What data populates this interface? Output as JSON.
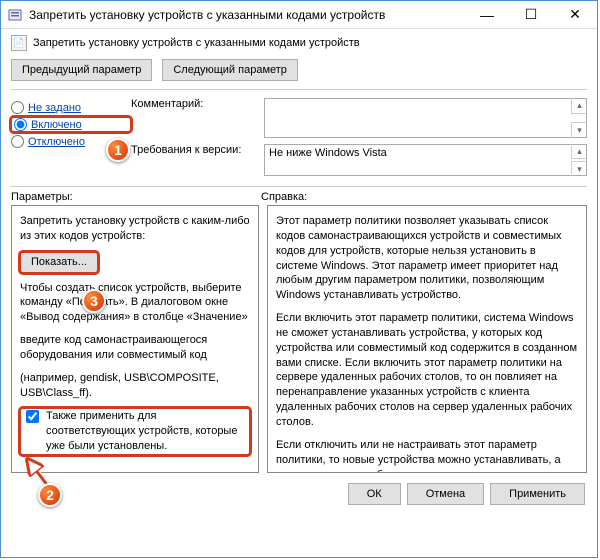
{
  "window": {
    "title": "Запретить установку устройств с указанными кодами устройств"
  },
  "subheader": {
    "title": "Запретить установку устройств с указанными кодами устройств"
  },
  "nav": {
    "prev": "Предыдущий параметр",
    "next": "Следующий параметр"
  },
  "state": {
    "not_configured": "Не задано",
    "enabled": "Включено",
    "disabled": "Отключено",
    "selected": "enabled"
  },
  "comment": {
    "label": "Комментарий:",
    "value": ""
  },
  "supported": {
    "label": "Требования к версии:",
    "value": "Не ниже Windows Vista"
  },
  "labels": {
    "options": "Параметры:",
    "help": "Справка:"
  },
  "options": {
    "intro": "Запретить установку устройств с каким-либо из этих кодов устройств:",
    "show_button": "Показать...",
    "hint1": "Чтобы создать список устройств, выберите команду «Показать». В диалоговом окне «Вывод содержания» в столбце «Значение»",
    "hint2": "введите код самонастраивающегося оборудования или совместимый код",
    "hint3": "(например, gendisk, USB\\COMPOSITE, USB\\Class_ff).",
    "checkbox_label": "Также применить для соответствующих устройств, которые уже были установлены.",
    "checkbox_checked": true
  },
  "help": {
    "p1": "Этот параметр политики позволяет указывать список кодов самонастраивающихся устройств и совместимых кодов для устройств, которые нельзя установить в системе Windows. Этот параметр имеет приоритет над любым другим параметром политики, позволяющим Windows устанавливать устройство.",
    "p2": "Если включить этот параметр политики, система Windows не сможет устанавливать устройства, у которых код устройства или совместимый код содержится в созданном вами списке. Если включить этот параметр политики на сервере удаленных рабочих столов, то он повлияет на перенаправление указанных устройств с клиента удаленных рабочих столов на сервер удаленных рабочих столов.",
    "p3": "Если отключить или не настраивать этот параметр политики, то новые устройства можно устанавливать, а существующие — обновлять, насколько это разрешено или запрещено другими параметрами политики."
  },
  "footer": {
    "ok": "ОК",
    "cancel": "Отмена",
    "apply": "Применить"
  },
  "annotations": {
    "c1": "1",
    "c2": "2",
    "c3": "3"
  }
}
